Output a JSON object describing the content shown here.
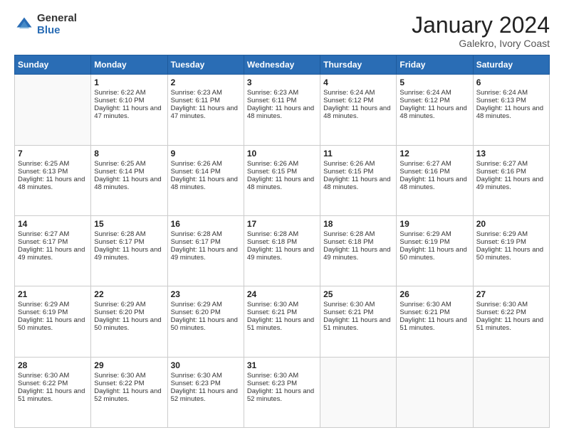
{
  "header": {
    "logo_general": "General",
    "logo_blue": "Blue",
    "title": "January 2024",
    "location": "Galekro, Ivory Coast"
  },
  "days_of_week": [
    "Sunday",
    "Monday",
    "Tuesday",
    "Wednesday",
    "Thursday",
    "Friday",
    "Saturday"
  ],
  "weeks": [
    [
      {
        "day": "",
        "sunrise": "",
        "sunset": "",
        "daylight": ""
      },
      {
        "day": "1",
        "sunrise": "Sunrise: 6:22 AM",
        "sunset": "Sunset: 6:10 PM",
        "daylight": "Daylight: 11 hours and 47 minutes."
      },
      {
        "day": "2",
        "sunrise": "Sunrise: 6:23 AM",
        "sunset": "Sunset: 6:11 PM",
        "daylight": "Daylight: 11 hours and 47 minutes."
      },
      {
        "day": "3",
        "sunrise": "Sunrise: 6:23 AM",
        "sunset": "Sunset: 6:11 PM",
        "daylight": "Daylight: 11 hours and 48 minutes."
      },
      {
        "day": "4",
        "sunrise": "Sunrise: 6:24 AM",
        "sunset": "Sunset: 6:12 PM",
        "daylight": "Daylight: 11 hours and 48 minutes."
      },
      {
        "day": "5",
        "sunrise": "Sunrise: 6:24 AM",
        "sunset": "Sunset: 6:12 PM",
        "daylight": "Daylight: 11 hours and 48 minutes."
      },
      {
        "day": "6",
        "sunrise": "Sunrise: 6:24 AM",
        "sunset": "Sunset: 6:13 PM",
        "daylight": "Daylight: 11 hours and 48 minutes."
      }
    ],
    [
      {
        "day": "7",
        "sunrise": "Sunrise: 6:25 AM",
        "sunset": "Sunset: 6:13 PM",
        "daylight": "Daylight: 11 hours and 48 minutes."
      },
      {
        "day": "8",
        "sunrise": "Sunrise: 6:25 AM",
        "sunset": "Sunset: 6:14 PM",
        "daylight": "Daylight: 11 hours and 48 minutes."
      },
      {
        "day": "9",
        "sunrise": "Sunrise: 6:26 AM",
        "sunset": "Sunset: 6:14 PM",
        "daylight": "Daylight: 11 hours and 48 minutes."
      },
      {
        "day": "10",
        "sunrise": "Sunrise: 6:26 AM",
        "sunset": "Sunset: 6:15 PM",
        "daylight": "Daylight: 11 hours and 48 minutes."
      },
      {
        "day": "11",
        "sunrise": "Sunrise: 6:26 AM",
        "sunset": "Sunset: 6:15 PM",
        "daylight": "Daylight: 11 hours and 48 minutes."
      },
      {
        "day": "12",
        "sunrise": "Sunrise: 6:27 AM",
        "sunset": "Sunset: 6:16 PM",
        "daylight": "Daylight: 11 hours and 48 minutes."
      },
      {
        "day": "13",
        "sunrise": "Sunrise: 6:27 AM",
        "sunset": "Sunset: 6:16 PM",
        "daylight": "Daylight: 11 hours and 49 minutes."
      }
    ],
    [
      {
        "day": "14",
        "sunrise": "Sunrise: 6:27 AM",
        "sunset": "Sunset: 6:17 PM",
        "daylight": "Daylight: 11 hours and 49 minutes."
      },
      {
        "day": "15",
        "sunrise": "Sunrise: 6:28 AM",
        "sunset": "Sunset: 6:17 PM",
        "daylight": "Daylight: 11 hours and 49 minutes."
      },
      {
        "day": "16",
        "sunrise": "Sunrise: 6:28 AM",
        "sunset": "Sunset: 6:17 PM",
        "daylight": "Daylight: 11 hours and 49 minutes."
      },
      {
        "day": "17",
        "sunrise": "Sunrise: 6:28 AM",
        "sunset": "Sunset: 6:18 PM",
        "daylight": "Daylight: 11 hours and 49 minutes."
      },
      {
        "day": "18",
        "sunrise": "Sunrise: 6:28 AM",
        "sunset": "Sunset: 6:18 PM",
        "daylight": "Daylight: 11 hours and 49 minutes."
      },
      {
        "day": "19",
        "sunrise": "Sunrise: 6:29 AM",
        "sunset": "Sunset: 6:19 PM",
        "daylight": "Daylight: 11 hours and 50 minutes."
      },
      {
        "day": "20",
        "sunrise": "Sunrise: 6:29 AM",
        "sunset": "Sunset: 6:19 PM",
        "daylight": "Daylight: 11 hours and 50 minutes."
      }
    ],
    [
      {
        "day": "21",
        "sunrise": "Sunrise: 6:29 AM",
        "sunset": "Sunset: 6:19 PM",
        "daylight": "Daylight: 11 hours and 50 minutes."
      },
      {
        "day": "22",
        "sunrise": "Sunrise: 6:29 AM",
        "sunset": "Sunset: 6:20 PM",
        "daylight": "Daylight: 11 hours and 50 minutes."
      },
      {
        "day": "23",
        "sunrise": "Sunrise: 6:29 AM",
        "sunset": "Sunset: 6:20 PM",
        "daylight": "Daylight: 11 hours and 50 minutes."
      },
      {
        "day": "24",
        "sunrise": "Sunrise: 6:30 AM",
        "sunset": "Sunset: 6:21 PM",
        "daylight": "Daylight: 11 hours and 51 minutes."
      },
      {
        "day": "25",
        "sunrise": "Sunrise: 6:30 AM",
        "sunset": "Sunset: 6:21 PM",
        "daylight": "Daylight: 11 hours and 51 minutes."
      },
      {
        "day": "26",
        "sunrise": "Sunrise: 6:30 AM",
        "sunset": "Sunset: 6:21 PM",
        "daylight": "Daylight: 11 hours and 51 minutes."
      },
      {
        "day": "27",
        "sunrise": "Sunrise: 6:30 AM",
        "sunset": "Sunset: 6:22 PM",
        "daylight": "Daylight: 11 hours and 51 minutes."
      }
    ],
    [
      {
        "day": "28",
        "sunrise": "Sunrise: 6:30 AM",
        "sunset": "Sunset: 6:22 PM",
        "daylight": "Daylight: 11 hours and 51 minutes."
      },
      {
        "day": "29",
        "sunrise": "Sunrise: 6:30 AM",
        "sunset": "Sunset: 6:22 PM",
        "daylight": "Daylight: 11 hours and 52 minutes."
      },
      {
        "day": "30",
        "sunrise": "Sunrise: 6:30 AM",
        "sunset": "Sunset: 6:23 PM",
        "daylight": "Daylight: 11 hours and 52 minutes."
      },
      {
        "day": "31",
        "sunrise": "Sunrise: 6:30 AM",
        "sunset": "Sunset: 6:23 PM",
        "daylight": "Daylight: 11 hours and 52 minutes."
      },
      {
        "day": "",
        "sunrise": "",
        "sunset": "",
        "daylight": ""
      },
      {
        "day": "",
        "sunrise": "",
        "sunset": "",
        "daylight": ""
      },
      {
        "day": "",
        "sunrise": "",
        "sunset": "",
        "daylight": ""
      }
    ]
  ]
}
